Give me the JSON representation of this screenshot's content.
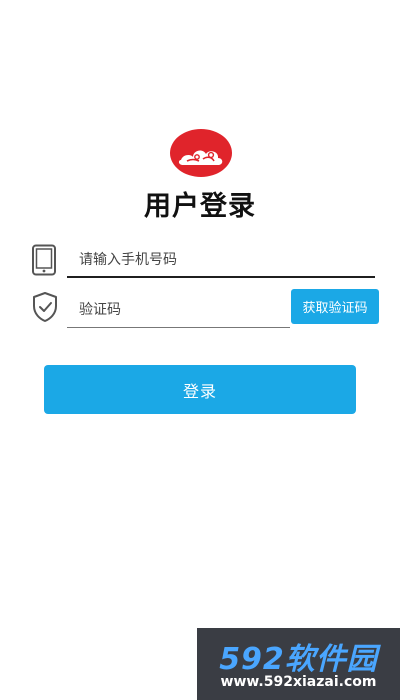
{
  "header": {
    "logo_icon": "cloud-logo-icon",
    "title": "用户登录"
  },
  "form": {
    "phone": {
      "icon": "phone-icon",
      "placeholder": "请输入手机号码",
      "value": ""
    },
    "code": {
      "icon": "shield-check-icon",
      "placeholder": "验证码",
      "value": ""
    },
    "get_code_label": "获取验证码",
    "login_label": "登录"
  },
  "watermark": {
    "brand": "592软件园",
    "url": "www.592xiazai.com"
  },
  "colors": {
    "accent": "#1ba8e6",
    "logo_red": "#e0242b",
    "text": "#111111",
    "watermark_bg": "#3a3d44",
    "watermark_brand": "#4aa6ff"
  }
}
